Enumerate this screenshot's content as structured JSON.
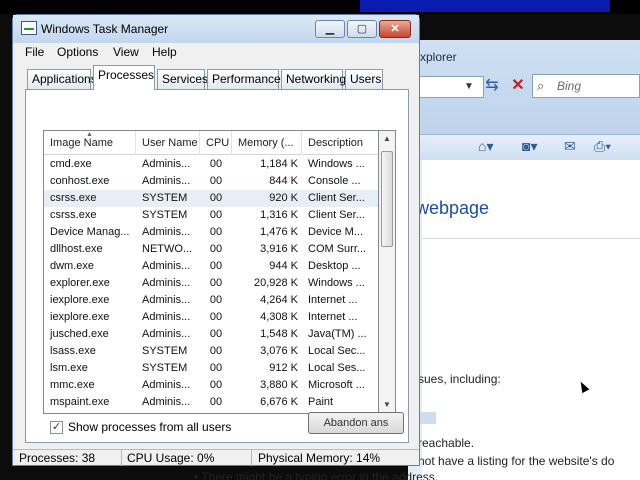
{
  "window": {
    "title": "Windows Task Manager",
    "controls": {
      "minimize": "▁",
      "maximize": "▢",
      "close": "✕"
    }
  },
  "menu": [
    "File",
    "Options",
    "View",
    "Help"
  ],
  "tabs": [
    {
      "label": "Applications",
      "active": false
    },
    {
      "label": "Processes",
      "active": true
    },
    {
      "label": "Services",
      "active": false
    },
    {
      "label": "Performance",
      "active": false
    },
    {
      "label": "Networking",
      "active": false
    },
    {
      "label": "Users",
      "active": false
    }
  ],
  "table": {
    "columns": [
      "Image Name",
      "User Name",
      "CPU",
      "Memory (...",
      "Description"
    ],
    "rows": [
      [
        "cmd.exe",
        "Adminis...",
        "00",
        "1,184 K",
        "Windows ..."
      ],
      [
        "conhost.exe",
        "Adminis...",
        "00",
        "844 K",
        "Console ..."
      ],
      [
        "csrss.exe",
        "SYSTEM",
        "00",
        "920 K",
        "Client Ser..."
      ],
      [
        "csrss.exe",
        "SYSTEM",
        "00",
        "1,316 K",
        "Client Ser..."
      ],
      [
        "Device Manag...",
        "Adminis...",
        "00",
        "1,476 K",
        "Device M..."
      ],
      [
        "dllhost.exe",
        "NETWO...",
        "00",
        "3,916 K",
        "COM Surr..."
      ],
      [
        "dwm.exe",
        "Adminis...",
        "00",
        "944 K",
        "Desktop ..."
      ],
      [
        "explorer.exe",
        "Adminis...",
        "00",
        "20,928 K",
        "Windows ..."
      ],
      [
        "iexplore.exe",
        "Adminis...",
        "00",
        "4,264 K",
        "Internet ..."
      ],
      [
        "iexplore.exe",
        "Adminis...",
        "00",
        "4,308 K",
        "Internet ..."
      ],
      [
        "jusched.exe",
        "Adminis...",
        "00",
        "1,548 K",
        "Java(TM) ..."
      ],
      [
        "lsass.exe",
        "SYSTEM",
        "00",
        "3,076 K",
        "Local Sec..."
      ],
      [
        "lsm.exe",
        "SYSTEM",
        "00",
        "912 K",
        "Local Ses..."
      ],
      [
        "mmc.exe",
        "Adminis...",
        "00",
        "3,880 K",
        "Microsoft ..."
      ],
      [
        "mspaint.exe",
        "Adminis...",
        "00",
        "6,676 K",
        "Paint"
      ]
    ],
    "selected_row": 2
  },
  "show_all": {
    "label": "Show processes from all users",
    "checked": true
  },
  "end_process_label": "Abandon ans",
  "status": {
    "processes": "Processes: 38",
    "cpu": "CPU Usage: 0%",
    "memory": "Physical Memory: 14%"
  },
  "background": {
    "title": "xplorer",
    "search_placeholder": "Bing",
    "heading": "webpage",
    "lines": [
      "sues, including:",
      "reachable.",
      "not have a listing for the website's do",
      "• There might be a typing error in the address."
    ],
    "icons": [
      "home-icon",
      "feeds-icon",
      "mail-icon",
      "print-icon",
      "refresh-icon",
      "stop-icon",
      "search-icon"
    ]
  }
}
